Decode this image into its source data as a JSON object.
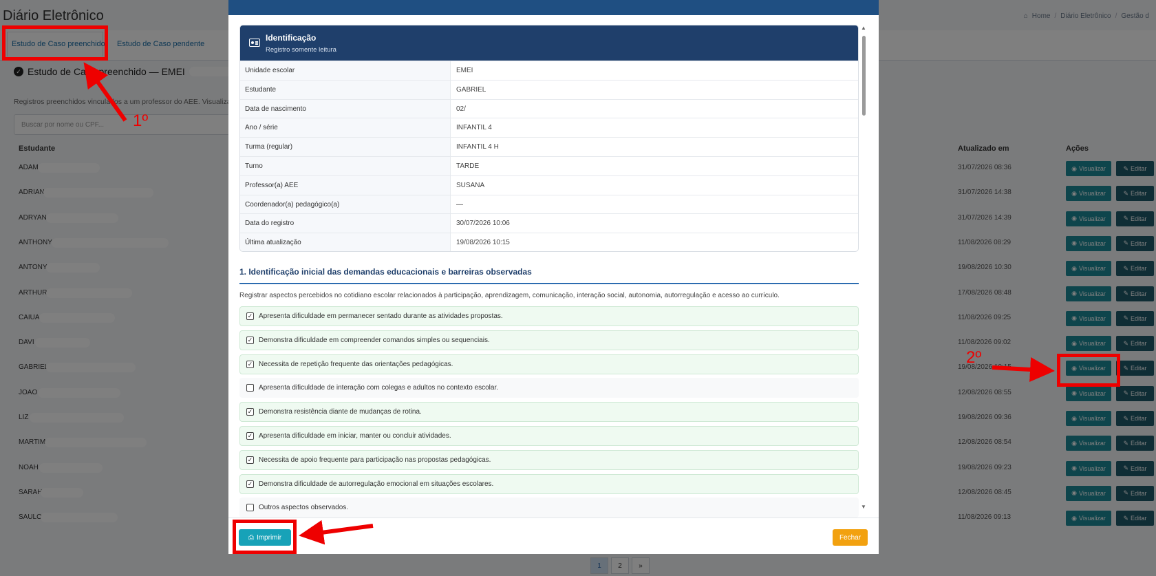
{
  "page": {
    "title": "Diário Eletrônico",
    "breadcrumb": [
      "Home",
      "Diário Eletrônico",
      "Gestão d"
    ]
  },
  "tabs": [
    "Estudo de Caso preenchido",
    "Estudo de Caso pendente"
  ],
  "section": {
    "heading": "Estudo de Caso preenchido — EMEI",
    "description": "Registros preenchidos vinculados a um professor do AEE. Visualizar o",
    "search_placeholder": "Buscar por nome ou CPF..."
  },
  "table": {
    "headers": {
      "student": "Estudante",
      "updated": "Atualizado em",
      "actions": "Ações"
    },
    "view_label": "Visualizar",
    "edit_label": "Editar",
    "rows": [
      {
        "name": "ADAM",
        "updated": "31/07/2026 08:36"
      },
      {
        "name": "ADRIAN",
        "updated": "31/07/2026 14:38"
      },
      {
        "name": "ADRYAN",
        "updated": "31/07/2026 14:39"
      },
      {
        "name": "ANTHONY",
        "updated": "11/08/2026 08:29"
      },
      {
        "name": "ANTONY",
        "updated": "19/08/2026 10:30"
      },
      {
        "name": "ARTHUR",
        "updated": "17/08/2026 08:48"
      },
      {
        "name": "CAIUA",
        "updated": "11/08/2026 09:25"
      },
      {
        "name": "DAVI",
        "updated": "11/08/2026 09:02"
      },
      {
        "name": "GABRIEL",
        "updated": "19/08/2026 10:15"
      },
      {
        "name": "JOAO",
        "updated": "12/08/2026 08:55"
      },
      {
        "name": "LIZ",
        "updated": "19/08/2026 09:36"
      },
      {
        "name": "MARTIM",
        "updated": "12/08/2026 08:54"
      },
      {
        "name": "NOAH",
        "updated": "19/08/2026 09:23"
      },
      {
        "name": "SARAH",
        "updated": "12/08/2026 08:45"
      },
      {
        "name": "SAULO",
        "updated": "11/08/2026 09:13"
      }
    ]
  },
  "pagination": {
    "current": "1",
    "next": "2",
    "arrow": "»"
  },
  "modal": {
    "card": {
      "title": "Identificação",
      "subtitle": "Registro somente leitura",
      "fields": [
        {
          "label": "Unidade escolar",
          "value": "EMEI"
        },
        {
          "label": "Estudante",
          "value": "GABRIEL"
        },
        {
          "label": "Data de nascimento",
          "value": "02/"
        },
        {
          "label": "Ano / série",
          "value": "INFANTIL 4"
        },
        {
          "label": "Turma (regular)",
          "value": "INFANTIL 4 H"
        },
        {
          "label": "Turno",
          "value": "TARDE"
        },
        {
          "label": "Professor(a) AEE",
          "value": "SUSANA"
        },
        {
          "label": "Coordenador(a) pedagógico(a)",
          "value": "—"
        },
        {
          "label": "Data do registro",
          "value": "30/07/2026 10:06"
        },
        {
          "label": "Última atualização",
          "value": "19/08/2026 10:15"
        }
      ]
    },
    "section1": {
      "title": "1. Identificação inicial das demandas educacionais e barreiras observadas",
      "description": "Registrar aspectos percebidos no cotidiano escolar relacionados à participação, aprendizagem, comunicação, interação social, autonomia, autorregulação e acesso ao currículo.",
      "items": [
        {
          "text": "Apresenta dificuldade em permanecer sentado durante as atividades propostas.",
          "checked": true
        },
        {
          "text": "Demonstra dificuldade em compreender comandos simples ou sequenciais.",
          "checked": true
        },
        {
          "text": "Necessita de repetição frequente das orientações pedagógicas.",
          "checked": true
        },
        {
          "text": "Apresenta dificuldade de interação com colegas e adultos no contexto escolar.",
          "checked": false
        },
        {
          "text": "Demonstra resistência diante de mudanças de rotina.",
          "checked": true
        },
        {
          "text": "Apresenta dificuldade em iniciar, manter ou concluir atividades.",
          "checked": true
        },
        {
          "text": "Necessita de apoio frequente para participação nas propostas pedagógicas.",
          "checked": true
        },
        {
          "text": "Demonstra dificuldade de autorregulação emocional em situações escolares.",
          "checked": true
        },
        {
          "text": "Outros aspectos observados.",
          "checked": false
        }
      ]
    },
    "print_label": "Imprimir",
    "close_label": "Fechar"
  },
  "annotations": {
    "step1": "1º",
    "step2": "2º"
  },
  "colors": {
    "annotation": "#ee0000",
    "print": "#17a2b8",
    "close": "#f2a10f",
    "card_header": "#1f3f6b"
  }
}
